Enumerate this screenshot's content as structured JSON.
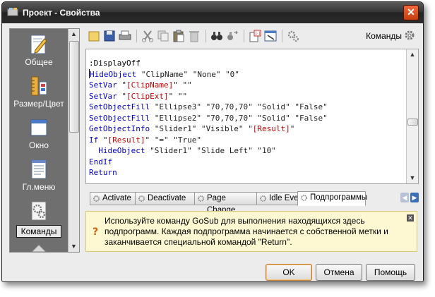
{
  "window": {
    "title": "Проект - Свойства",
    "close_glyph": "✕"
  },
  "sidebar": {
    "items": [
      {
        "label": "Общее",
        "icon": "pencil-page-icon",
        "selected": false
      },
      {
        "label": "Размер/Цвет",
        "icon": "ruler-palette-icon",
        "selected": false
      },
      {
        "label": "Окно",
        "icon": "window-icon",
        "selected": false
      },
      {
        "label": "Гл.меню",
        "icon": "menu-page-icon",
        "selected": false
      },
      {
        "label": "Команды",
        "icon": "gear-page-icon",
        "selected": true
      }
    ]
  },
  "toolbar": {
    "buttons": [
      "new-icon",
      "save-icon",
      "print-icon",
      "cut-icon",
      "copy-icon",
      "paste-icon",
      "delete-icon",
      "find-icon",
      "replace-icon",
      "insert-variable-icon",
      "insert-object-icon",
      "settings-icon"
    ],
    "commands_label": "Команды"
  },
  "editor": {
    "lines": [
      [
        {
          "t": "pl",
          "v": ":DisplayOff"
        }
      ],
      [
        {
          "t": "caret"
        },
        {
          "t": "kw",
          "v": "HideObject"
        },
        {
          "t": "st",
          "v": " \"ClipName\" \"None\" \"0\""
        }
      ],
      [
        {
          "t": "kw",
          "v": "SetVar"
        },
        {
          "t": "st",
          "v": " \""
        },
        {
          "t": "vr",
          "v": "[ClipName]"
        },
        {
          "t": "st",
          "v": "\" \"\""
        }
      ],
      [
        {
          "t": "kw",
          "v": "SetVar"
        },
        {
          "t": "st",
          "v": " \""
        },
        {
          "t": "vr",
          "v": "[ClipExt]"
        },
        {
          "t": "st",
          "v": "\" \"\""
        }
      ],
      [
        {
          "t": "kw",
          "v": "SetObjectFill"
        },
        {
          "t": "st",
          "v": " \"Ellipse3\" \"70,70,70\" \"Solid\" \"False\""
        }
      ],
      [
        {
          "t": "kw",
          "v": "SetObjectFill"
        },
        {
          "t": "st",
          "v": " \"Ellipse2\" \"70,70,70\" \"Solid\" \"False\""
        }
      ],
      [
        {
          "t": "kw",
          "v": "GetObjectInfo"
        },
        {
          "t": "st",
          "v": " \"Slider1\" \"Visible\" \""
        },
        {
          "t": "vr",
          "v": "[Result]"
        },
        {
          "t": "st",
          "v": "\""
        }
      ],
      [
        {
          "t": "kw",
          "v": "If"
        },
        {
          "t": "st",
          "v": " \""
        },
        {
          "t": "vr",
          "v": "[Result]"
        },
        {
          "t": "st",
          "v": "\" \"=\" \"True\""
        }
      ],
      [
        {
          "t": "kw",
          "v": "  HideObject"
        },
        {
          "t": "st",
          "v": " \"Slider1\" \"Slide Left\" \"10\""
        }
      ],
      [
        {
          "t": "kw",
          "v": "EndIf"
        }
      ],
      [
        {
          "t": "kw",
          "v": "Return"
        }
      ]
    ]
  },
  "tabs": [
    {
      "label": "Activate",
      "active": false
    },
    {
      "label": "Deactivate",
      "active": false
    },
    {
      "label": "Page Change",
      "active": false
    },
    {
      "label": "Idle Event",
      "active": false
    },
    {
      "label": "Подпрограммы",
      "active": true
    }
  ],
  "info": {
    "text": "Используйте команду GoSub для выполнения находящихся здесь подпрограмм. Каждая подпрограмма начинается с собственной метки и заканчивается специальной командой \"Return\".",
    "close_glyph": "✕",
    "icon": "question-icon"
  },
  "buttons": {
    "ok": "OK",
    "cancel": "Отмена",
    "help": "Помощь"
  },
  "colors": {
    "keyword": "#0000cc",
    "variable": "#cc0000",
    "info_bg": "#fdf8d2"
  }
}
